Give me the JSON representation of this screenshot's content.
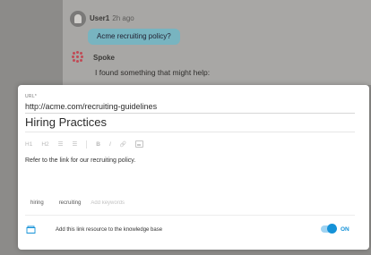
{
  "chat": {
    "user_message": {
      "sender": "User1",
      "time": "2h ago",
      "text": "Acme recruiting policy?"
    },
    "bot_message": {
      "sender": "Spoke",
      "text": "I found something that might help:"
    }
  },
  "modal": {
    "url_label": "URL*",
    "url_value": "http://acme.com/recruiting-guidelines",
    "title": "Hiring Practices",
    "toolbar": {
      "h1": "H1",
      "h2": "H2",
      "bullet_list": "☰",
      "numbered_list": "☰",
      "bold": "B",
      "italic": "I",
      "link": "🔗"
    },
    "description": "Refer to the link for our recruiting policy.",
    "keywords": [
      "hiring",
      "recruiting"
    ],
    "keywords_placeholder": "Add keywords",
    "footer_text": "Add this link resource to the knowledge base",
    "toggle_label": "ON",
    "toggle_on": true,
    "accent_color": "#1592d8"
  }
}
